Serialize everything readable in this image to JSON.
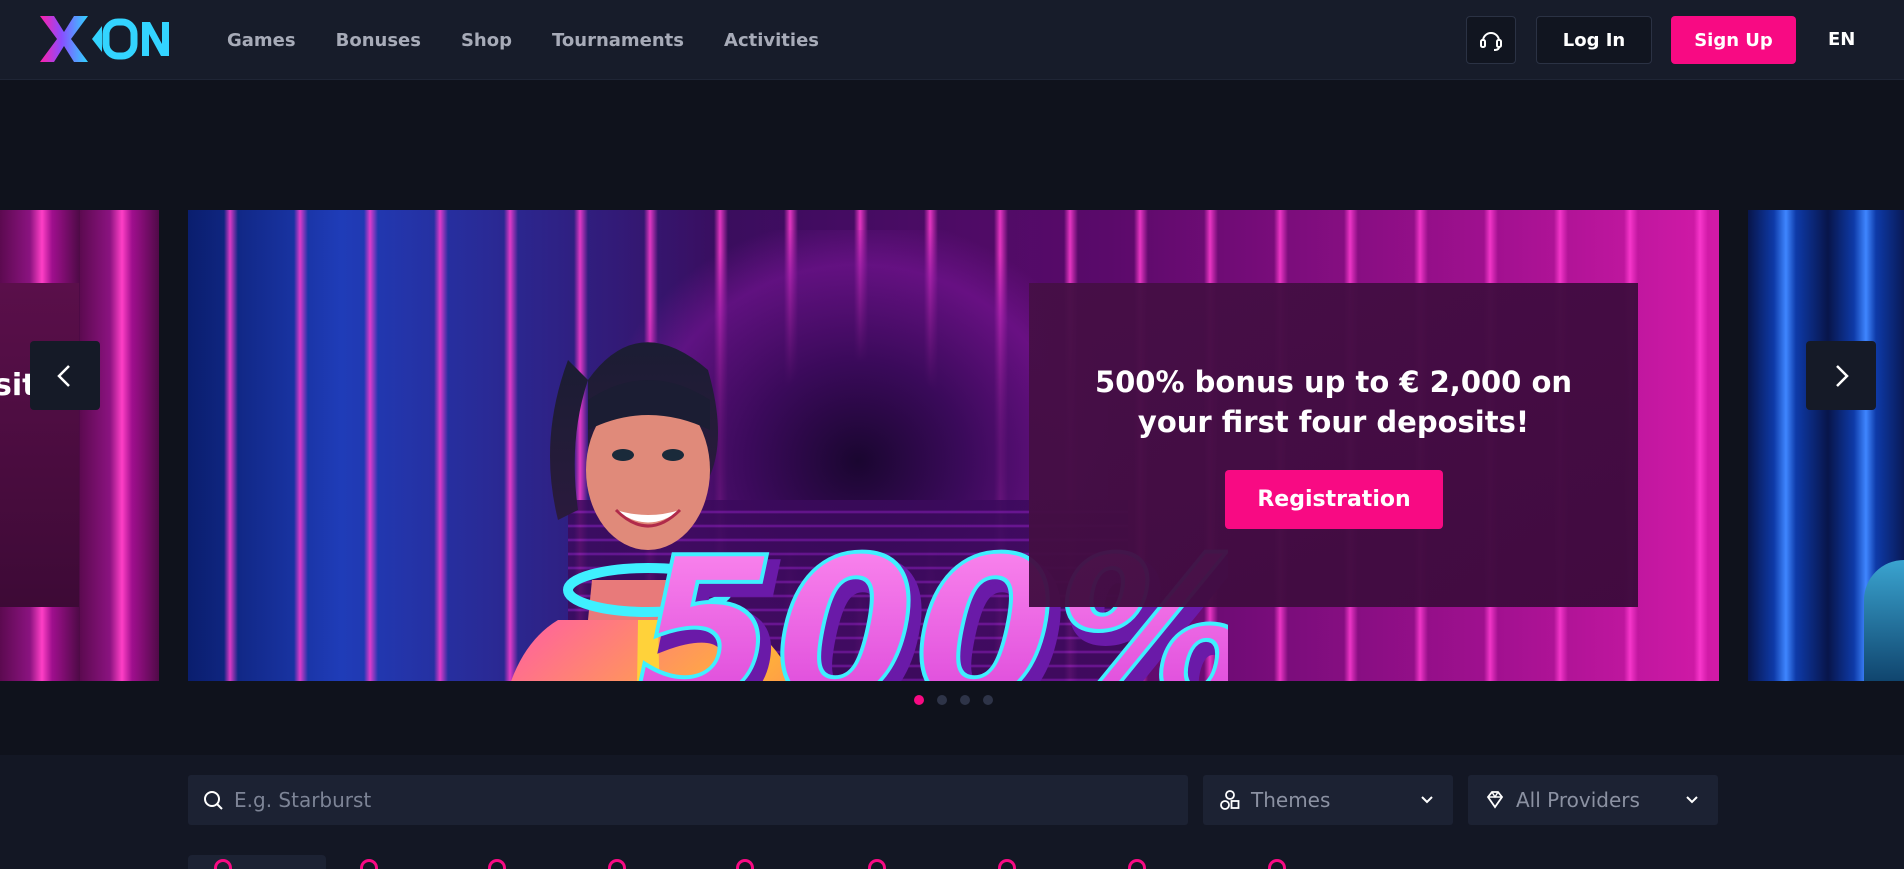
{
  "header": {
    "brand": "XON",
    "nav": [
      {
        "label": "Games"
      },
      {
        "label": "Bonuses"
      },
      {
        "label": "Shop"
      },
      {
        "label": "Tournaments"
      },
      {
        "label": "Activities"
      }
    ],
    "login_label": "Log In",
    "signup_label": "Sign Up",
    "language": "EN",
    "support_icon": "headset-icon"
  },
  "hero": {
    "left_slide_text": "sit",
    "promo_graphic_text": "500%",
    "bonus_text": "500% bonus up to € 2,000 on your first four deposits!",
    "cta_label": "Registration",
    "slide_count": 4,
    "active_slide": 1,
    "prev_icon": "chevron-left-icon",
    "next_icon": "chevron-right-icon"
  },
  "filters": {
    "search_placeholder": "E.g. Starburst",
    "themes_label": "Themes",
    "providers_label": "All Providers"
  },
  "colors": {
    "accent": "#f80a83",
    "header_bg": "#171c2a",
    "page_bg": "#0f121c"
  }
}
